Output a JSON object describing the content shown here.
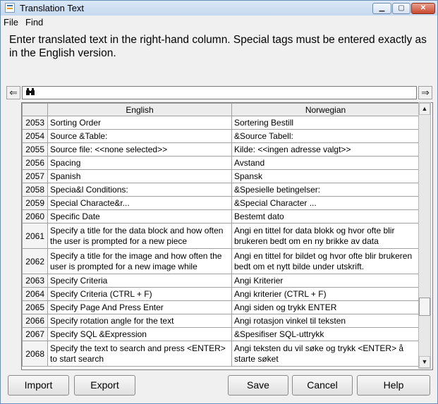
{
  "window": {
    "title": "Translation Text"
  },
  "titlebar_buttons": {
    "minimize": "▁",
    "maximize": "▢",
    "close": "✕"
  },
  "menu": [
    "File",
    "Find"
  ],
  "instructions": "Enter translated text in the right-hand column. Special tags must be entered exactly as in the English version.",
  "search": {
    "prev_glyph": "⇐",
    "next_glyph": "⇒",
    "icon": "binoculars-icon",
    "glyph": "⛶",
    "value": ""
  },
  "table": {
    "headers": [
      "",
      "English",
      "Norwegian"
    ],
    "rows": [
      {
        "id": "2053",
        "english": "Sorting Order",
        "norwegian": "Sortering Bestill"
      },
      {
        "id": "2054",
        "english": "Source &Table:",
        "norwegian": "&Source Tabell:"
      },
      {
        "id": "2055",
        "english": "Source file: <<none selected>>",
        "norwegian": "Kilde: <<ingen adresse valgt>>"
      },
      {
        "id": "2056",
        "english": "Spacing",
        "norwegian": "Avstand"
      },
      {
        "id": "2057",
        "english": "Spanish",
        "norwegian": "Spansk"
      },
      {
        "id": "2058",
        "english": "Specia&l Conditions:",
        "norwegian": "&Spesielle betingelser:"
      },
      {
        "id": "2059",
        "english": "Special Characte&r...",
        "norwegian": "&Special Character ..."
      },
      {
        "id": "2060",
        "english": "Specific Date",
        "norwegian": "Bestemt dato"
      },
      {
        "id": "2061",
        "english": "Specify a title for the data block and how often the user is prompted for a new piece",
        "norwegian": "Angi en tittel for data blokk og hvor ofte blir brukeren bedt om en ny brikke av data"
      },
      {
        "id": "2062",
        "english": "Specify a title for the image and how often the user is prompted for a new image while",
        "norwegian": "Angi en tittel for bildet og hvor ofte blir brukeren bedt om et nytt bilde under utskrift."
      },
      {
        "id": "2063",
        "english": "Specify Criteria",
        "norwegian": "Angi Kriterier"
      },
      {
        "id": "2064",
        "english": "Specify Criteria (CTRL + F)",
        "norwegian": "Angi kriterier (CTRL + F)"
      },
      {
        "id": "2065",
        "english": "Specify Page And Press Enter",
        "norwegian": "Angi siden og trykk ENTER"
      },
      {
        "id": "2066",
        "english": "Specify rotation angle for the text",
        "norwegian": "Angi rotasjon vinkel til teksten"
      },
      {
        "id": "2067",
        "english": "Specify SQL &Expression",
        "norwegian": "&Spesifiser SQL-uttrykk"
      },
      {
        "id": "2068",
        "english": "Specify the text to search and press <ENTER> to start search",
        "norwegian": "Angi teksten du vil søke og trykk <ENTER> å starte søket"
      }
    ]
  },
  "scrollbar": {
    "up_glyph": "▲",
    "down_glyph": "▼",
    "position_fraction": 0.82
  },
  "buttons": {
    "import": "Import",
    "export": "Export",
    "save": "Save",
    "cancel": "Cancel",
    "help": "Help"
  }
}
